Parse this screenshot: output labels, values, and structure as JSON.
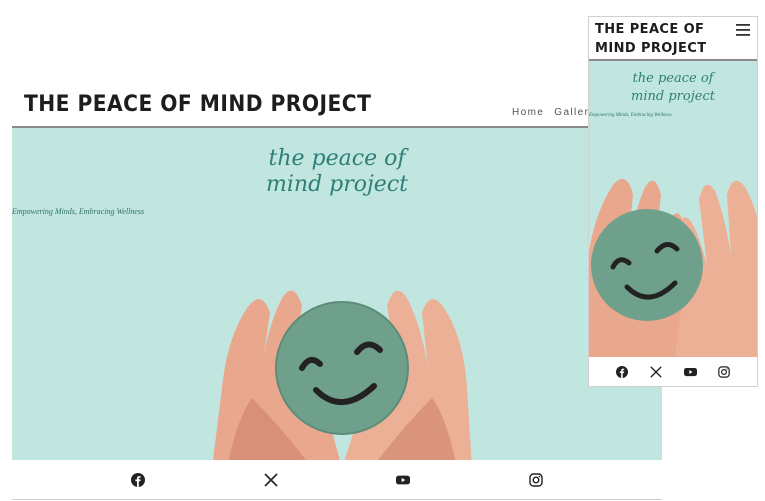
{
  "desktop": {
    "site_title": "THE PEACE OF MIND PROJECT",
    "nav": [
      "Home",
      "Galler"
    ],
    "hero": {
      "brand_line1": "the peace of",
      "brand_line2": "mind project",
      "tagline": "Empowering Minds, Embracing Wellness"
    },
    "social": [
      "facebook-icon",
      "x-icon",
      "youtube-icon",
      "instagram-icon"
    ]
  },
  "mobile": {
    "site_title": "THE PEACE OF MIND PROJECT",
    "menu_icon": "hamburger-icon",
    "hero": {
      "brand_line1": "the peace of",
      "brand_line2": "mind project",
      "tagline": "Empowering Minds, Embracing Wellness"
    },
    "social": [
      "facebook-icon",
      "x-icon",
      "youtube-icon",
      "instagram-icon"
    ]
  },
  "colors": {
    "hero_bg": "#c1e6e0",
    "brand_script": "#2f7f78",
    "smiley_disc": "#6fa08c",
    "title_text": "#1d1d1d"
  }
}
